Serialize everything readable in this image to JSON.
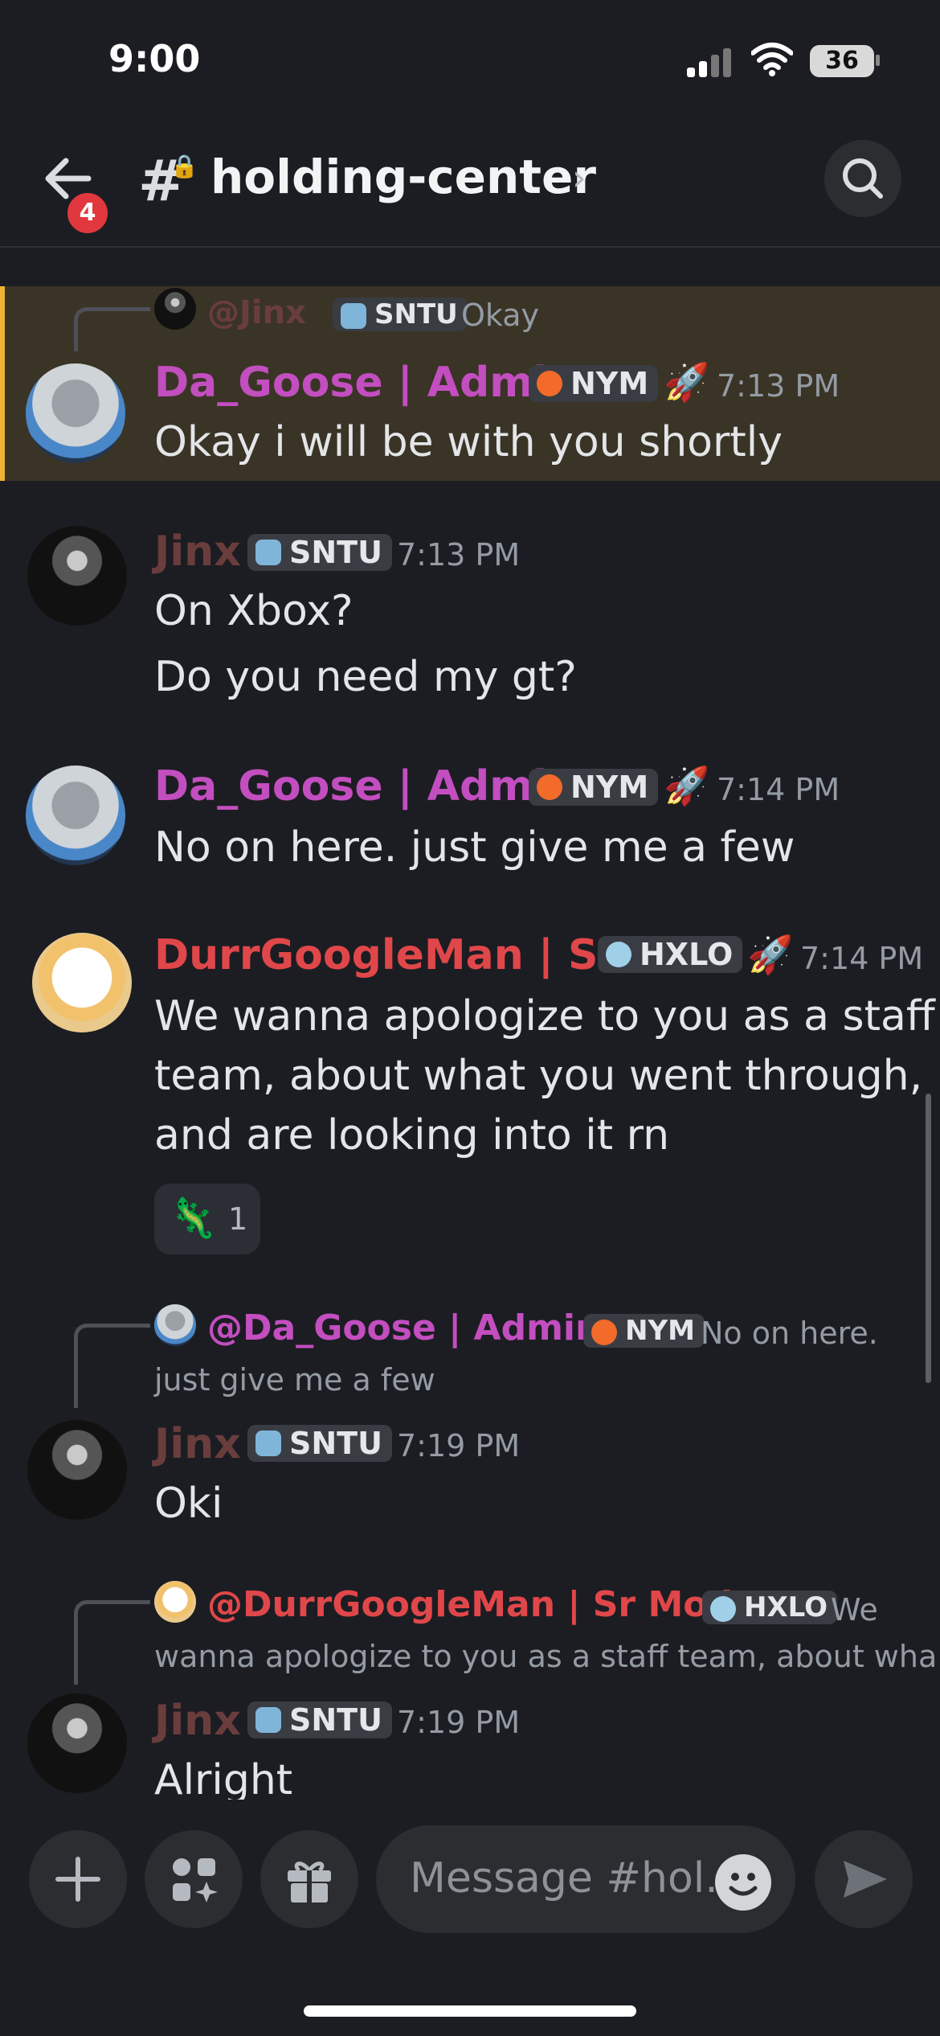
{
  "status_bar": {
    "time": "9:00",
    "battery": "36"
  },
  "header": {
    "channel": "holding-center",
    "notification_count": "4",
    "lock_icon": "🔒"
  },
  "messages": [
    {
      "reply": {
        "author": "@Jinx",
        "tag": "SNTU",
        "text": "Okay"
      },
      "author": "Da_Goose | Admin",
      "tag": "NYM",
      "time": "7:13 PM",
      "lines": [
        "Okay i will be with you shortly"
      ],
      "highlighted": true
    },
    {
      "author": "Jinx",
      "tag": "SNTU",
      "time": "7:13 PM",
      "lines": [
        "On Xbox?",
        "Do you need my gt?"
      ]
    },
    {
      "author": "Da_Goose | Admin",
      "tag": "NYM",
      "time": "7:14 PM",
      "lines": [
        "No on here. just give me a few"
      ]
    },
    {
      "author": "DurrGoogleMan | Sr...",
      "tag": "HXLO",
      "time": "7:14 PM",
      "lines": [
        "We wanna apologize to you as a staff",
        "team, about what you went through,",
        "and are looking into it rn"
      ],
      "reaction": {
        "emoji": "🦎",
        "count": "1"
      }
    },
    {
      "reply": {
        "author": "@Da_Goose | Admin",
        "tag": "NYM",
        "text": "No on here.",
        "text2": "just give me a few"
      },
      "author": "Jinx",
      "tag": "SNTU",
      "time": "7:19 PM",
      "lines": [
        "Oki"
      ]
    },
    {
      "reply": {
        "author": "@DurrGoogleMan | Sr Mod",
        "tag": "HXLO",
        "text": "We",
        "text2": "wanna apologize to you as a staff team, about wha..."
      },
      "author": "Jinx",
      "tag": "SNTU",
      "time": "7:19 PM",
      "lines": [
        "Alright"
      ]
    }
  ],
  "composer": {
    "placeholder": "Message #hol.."
  },
  "colors": {
    "admin": "#c34ec0",
    "mod": "#e0474a",
    "jinx": "#6a3d3d",
    "highlight_bar": "#f0b232",
    "badge": "#e0383e"
  }
}
